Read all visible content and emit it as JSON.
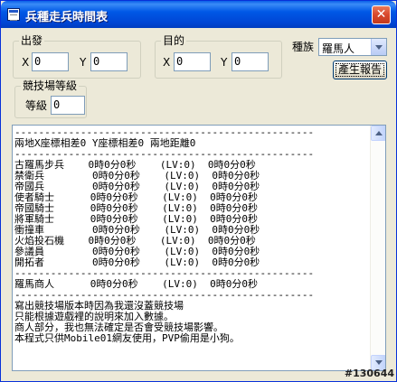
{
  "window": {
    "title": "兵種走兵時間表",
    "close_icon": "close-icon",
    "close_symbol": "✕"
  },
  "origin": {
    "label": "出發",
    "x_label": "X",
    "y_label": "Y",
    "x_value": "0",
    "y_value": "0"
  },
  "destination": {
    "label": "目的",
    "x_label": "X",
    "y_label": "Y",
    "x_value": "0",
    "y_value": "0"
  },
  "race": {
    "label": "種族",
    "selected": "羅馬人"
  },
  "generate_button": {
    "label": "產生報告"
  },
  "arena": {
    "label": "競技場等級",
    "level_label": "等級",
    "level_value": "0"
  },
  "report": {
    "lines": [
      "--------------------------------------------------",
      "兩地X座標相差0 Y座標相差0 兩地距離0",
      "--------------------------------------------------",
      "古羅馬步兵    0時0分0秒    (LV:0)  0時0分0秒",
      "禁衛兵        0時0分0秒    (LV:0)  0時0分0秒",
      "帝國兵        0時0分0秒    (LV:0)  0時0分0秒",
      "使者騎士      0時0分0秒    (LV:0)  0時0分0秒",
      "帝國騎士      0時0分0秒    (LV:0)  0時0分0秒",
      "將軍騎士      0時0分0秒    (LV:0)  0時0分0秒",
      "衝撞車        0時0分0秒    (LV:0)  0時0分0秒",
      "火焰投石機    0時0分0秒    (LV:0)  0時0分0秒",
      "參議員        0時0分0秒    (LV:0)  0時0分0秒",
      "開拓者        0時0分0秒    (LV:0)  0時0分0秒",
      "--------------------------------------------------",
      "羅馬商人      0時0分0秒    (LV:0)  0時0分0秒",
      "--------------------------------------------------",
      "寫出競技場版本時因為我還沒蓋競技場",
      "只能根據遊戲裡的說明來加入數據。",
      "商人部分，我也無法確定是否會受競技場影響。",
      "本程式只供Mobile01網友使用，PVP偷用是小狗。"
    ]
  },
  "watermark": "#130644"
}
